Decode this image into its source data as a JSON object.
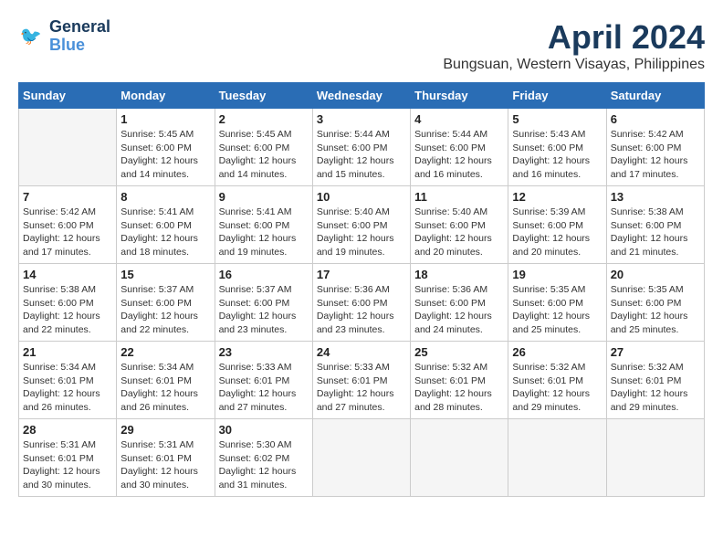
{
  "header": {
    "logo_line1": "General",
    "logo_line2": "Blue",
    "month": "April 2024",
    "location": "Bungsuan, Western Visayas, Philippines"
  },
  "weekdays": [
    "Sunday",
    "Monday",
    "Tuesday",
    "Wednesday",
    "Thursday",
    "Friday",
    "Saturday"
  ],
  "weeks": [
    [
      {
        "day": "",
        "empty": true
      },
      {
        "day": "1",
        "sunrise": "5:45 AM",
        "sunset": "6:00 PM",
        "daylight": "12 hours and 14 minutes."
      },
      {
        "day": "2",
        "sunrise": "5:45 AM",
        "sunset": "6:00 PM",
        "daylight": "12 hours and 14 minutes."
      },
      {
        "day": "3",
        "sunrise": "5:44 AM",
        "sunset": "6:00 PM",
        "daylight": "12 hours and 15 minutes."
      },
      {
        "day": "4",
        "sunrise": "5:44 AM",
        "sunset": "6:00 PM",
        "daylight": "12 hours and 16 minutes."
      },
      {
        "day": "5",
        "sunrise": "5:43 AM",
        "sunset": "6:00 PM",
        "daylight": "12 hours and 16 minutes."
      },
      {
        "day": "6",
        "sunrise": "5:42 AM",
        "sunset": "6:00 PM",
        "daylight": "12 hours and 17 minutes."
      }
    ],
    [
      {
        "day": "7",
        "sunrise": "5:42 AM",
        "sunset": "6:00 PM",
        "daylight": "12 hours and 17 minutes."
      },
      {
        "day": "8",
        "sunrise": "5:41 AM",
        "sunset": "6:00 PM",
        "daylight": "12 hours and 18 minutes."
      },
      {
        "day": "9",
        "sunrise": "5:41 AM",
        "sunset": "6:00 PM",
        "daylight": "12 hours and 19 minutes."
      },
      {
        "day": "10",
        "sunrise": "5:40 AM",
        "sunset": "6:00 PM",
        "daylight": "12 hours and 19 minutes."
      },
      {
        "day": "11",
        "sunrise": "5:40 AM",
        "sunset": "6:00 PM",
        "daylight": "12 hours and 20 minutes."
      },
      {
        "day": "12",
        "sunrise": "5:39 AM",
        "sunset": "6:00 PM",
        "daylight": "12 hours and 20 minutes."
      },
      {
        "day": "13",
        "sunrise": "5:38 AM",
        "sunset": "6:00 PM",
        "daylight": "12 hours and 21 minutes."
      }
    ],
    [
      {
        "day": "14",
        "sunrise": "5:38 AM",
        "sunset": "6:00 PM",
        "daylight": "12 hours and 22 minutes."
      },
      {
        "day": "15",
        "sunrise": "5:37 AM",
        "sunset": "6:00 PM",
        "daylight": "12 hours and 22 minutes."
      },
      {
        "day": "16",
        "sunrise": "5:37 AM",
        "sunset": "6:00 PM",
        "daylight": "12 hours and 23 minutes."
      },
      {
        "day": "17",
        "sunrise": "5:36 AM",
        "sunset": "6:00 PM",
        "daylight": "12 hours and 23 minutes."
      },
      {
        "day": "18",
        "sunrise": "5:36 AM",
        "sunset": "6:00 PM",
        "daylight": "12 hours and 24 minutes."
      },
      {
        "day": "19",
        "sunrise": "5:35 AM",
        "sunset": "6:00 PM",
        "daylight": "12 hours and 25 minutes."
      },
      {
        "day": "20",
        "sunrise": "5:35 AM",
        "sunset": "6:00 PM",
        "daylight": "12 hours and 25 minutes."
      }
    ],
    [
      {
        "day": "21",
        "sunrise": "5:34 AM",
        "sunset": "6:01 PM",
        "daylight": "12 hours and 26 minutes."
      },
      {
        "day": "22",
        "sunrise": "5:34 AM",
        "sunset": "6:01 PM",
        "daylight": "12 hours and 26 minutes."
      },
      {
        "day": "23",
        "sunrise": "5:33 AM",
        "sunset": "6:01 PM",
        "daylight": "12 hours and 27 minutes."
      },
      {
        "day": "24",
        "sunrise": "5:33 AM",
        "sunset": "6:01 PM",
        "daylight": "12 hours and 27 minutes."
      },
      {
        "day": "25",
        "sunrise": "5:32 AM",
        "sunset": "6:01 PM",
        "daylight": "12 hours and 28 minutes."
      },
      {
        "day": "26",
        "sunrise": "5:32 AM",
        "sunset": "6:01 PM",
        "daylight": "12 hours and 29 minutes."
      },
      {
        "day": "27",
        "sunrise": "5:32 AM",
        "sunset": "6:01 PM",
        "daylight": "12 hours and 29 minutes."
      }
    ],
    [
      {
        "day": "28",
        "sunrise": "5:31 AM",
        "sunset": "6:01 PM",
        "daylight": "12 hours and 30 minutes."
      },
      {
        "day": "29",
        "sunrise": "5:31 AM",
        "sunset": "6:01 PM",
        "daylight": "12 hours and 30 minutes."
      },
      {
        "day": "30",
        "sunrise": "5:30 AM",
        "sunset": "6:02 PM",
        "daylight": "12 hours and 31 minutes."
      },
      {
        "day": "",
        "empty": true
      },
      {
        "day": "",
        "empty": true
      },
      {
        "day": "",
        "empty": true
      },
      {
        "day": "",
        "empty": true
      }
    ]
  ],
  "labels": {
    "sunrise": "Sunrise:",
    "sunset": "Sunset:",
    "daylight": "Daylight:"
  }
}
